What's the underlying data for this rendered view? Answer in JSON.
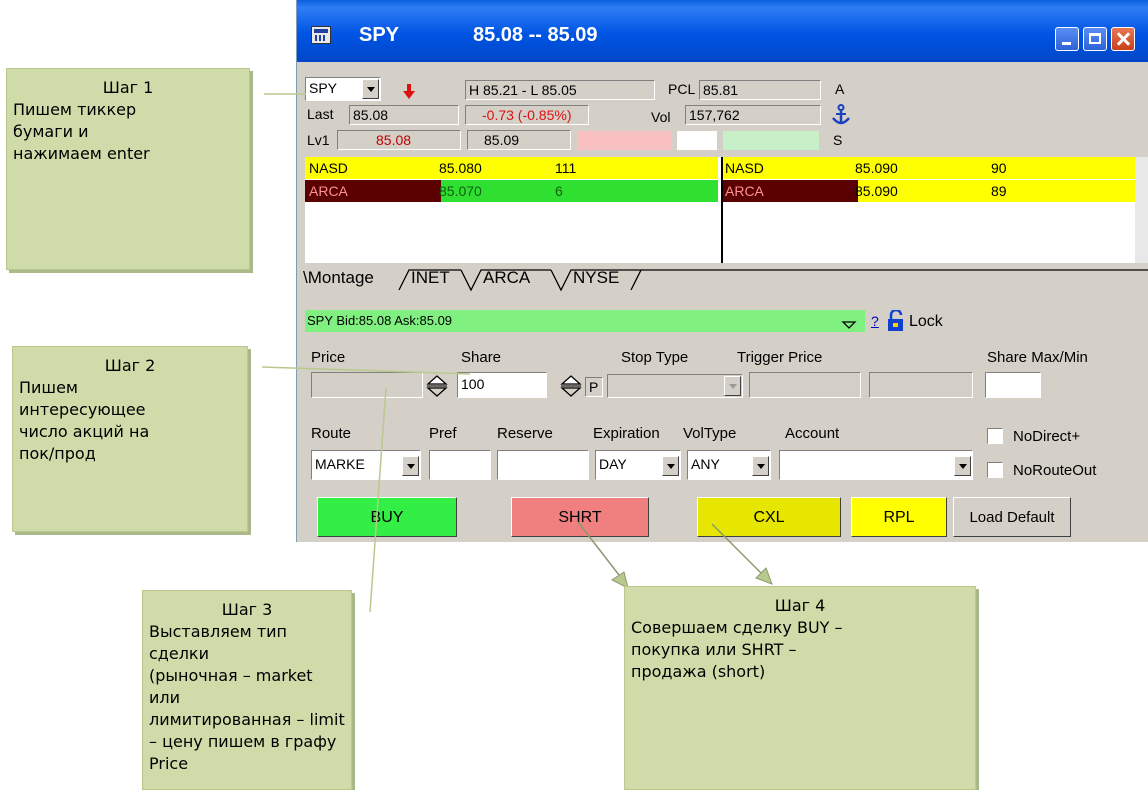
{
  "window": {
    "title_symbol": "SPY",
    "title_quote": "85.08 -- 85.09"
  },
  "header": {
    "symbol": "SPY",
    "high_low": "H 85.21 - L 85.05",
    "pcl_label": "PCL",
    "pcl_value": "85.81",
    "a_label": "A",
    "last_label": "Last",
    "last_value": "85.08",
    "change": "-0.73  (-0.85%)",
    "vol_label": "Vol",
    "vol_value": "157,762",
    "lv1_label": "Lv1",
    "lv1_bid": "85.08",
    "lv1_ask": "85.09",
    "s_label": "S"
  },
  "book": {
    "bids": [
      {
        "mm": "NASD",
        "price": "85.080",
        "size": "111"
      },
      {
        "mm": "ARCA",
        "price": "85.070",
        "size": "6"
      }
    ],
    "asks": [
      {
        "mm": "NASD",
        "price": "85.090",
        "size": "90"
      },
      {
        "mm": "ARCA",
        "price": "85.090",
        "size": "89"
      }
    ],
    "colors": {
      "yellow": "#ffff00",
      "maroon": "#5a0000",
      "green": "#30e030"
    }
  },
  "tabs": [
    "\\Montage",
    "INET",
    "ARCA",
    "NYSE"
  ],
  "status": {
    "text": "SPY Bid:85.08 Ask:85.09",
    "help": "?",
    "lock": "Lock"
  },
  "order": {
    "price_label": "Price",
    "share_label": "Share",
    "share_value": "100",
    "p_label": "P",
    "stop_type_label": "Stop Type",
    "trigger_price_label": "Trigger Price",
    "share_maxmin_label": "Share Max/Min",
    "route_label": "Route",
    "route_value": "MARKE",
    "pref_label": "Pref",
    "reserve_label": "Reserve",
    "expiration_label": "Expiration",
    "expiration_value": "DAY",
    "voltype_label": "VolType",
    "voltype_value": "ANY",
    "account_label": "Account",
    "nodirect_label": "NoDirect+",
    "norouteout_label": "NoRouteOut"
  },
  "buttons": {
    "buy": "BUY",
    "shrt": "SHRT",
    "cxl": "CXL",
    "rpl": "RPL",
    "load_default": "Load Default",
    "colors": {
      "buy": "#33ee44",
      "shrt": "#f08080",
      "cxl": "#e6e600",
      "rpl": "#ffff00"
    }
  },
  "notes": [
    {
      "title": "Шаг 1",
      "body": "Пишем тиккер\nбумаги и\nнажимаем enter"
    },
    {
      "title": "Шаг 2",
      "body": "Пишем\nинтересующее\nчисло акций на\nпок/прод"
    },
    {
      "title": "Шаг 3",
      "body": "Выставляем тип сделки\n(рыночная – market или\nлимитированная – limit\n– цену пишем в графу\nPrice"
    },
    {
      "title": "Шаг 4",
      "body": "Совершаем сделку BUY –\nпокупка или SHRT –\nпродажа (short)"
    }
  ]
}
